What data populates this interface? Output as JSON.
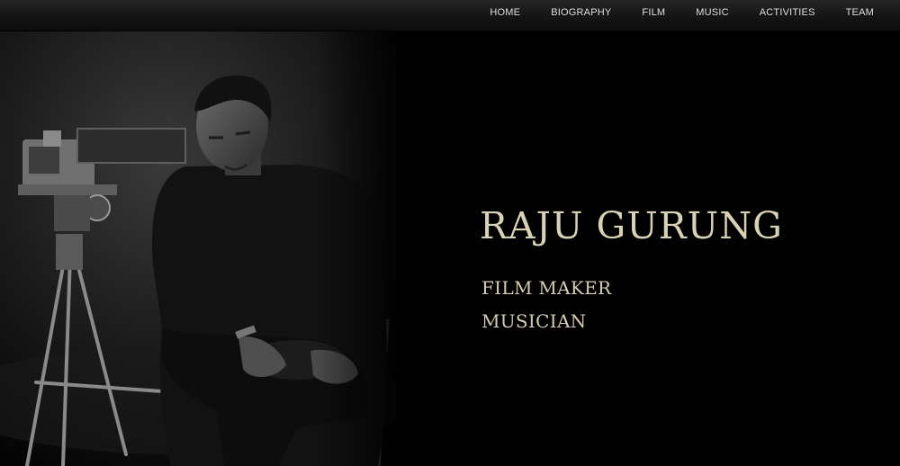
{
  "nav": {
    "items": [
      "HOME",
      "BIOGRAPHY",
      "FILM",
      "MUSIC",
      "ACTIVITIES",
      "TEAM"
    ]
  },
  "hero": {
    "name": "RAJU GURUNG",
    "roles": [
      "FILM MAKER",
      "MUSICIAN"
    ],
    "text_color": "#d8d1b4"
  }
}
